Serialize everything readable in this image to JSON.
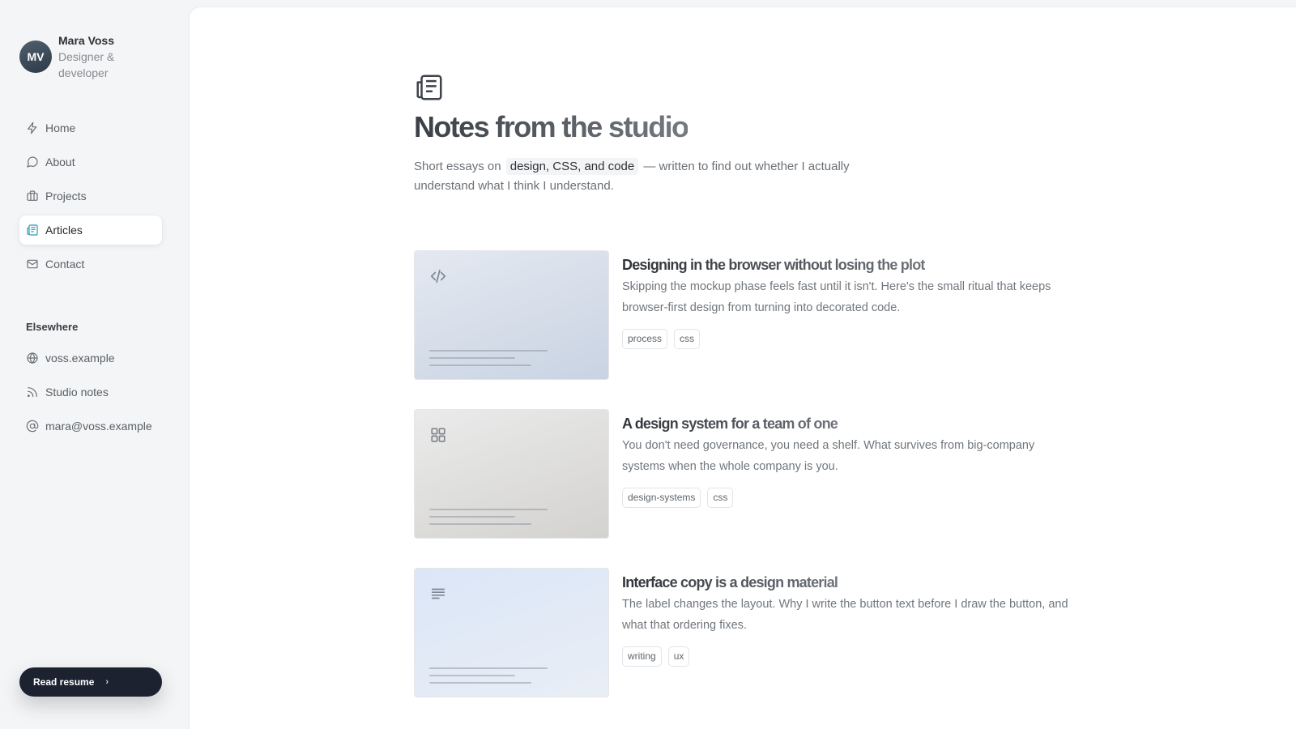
{
  "profile": {
    "initials": "MV",
    "name": "Mara Voss",
    "role": "Designer & developer"
  },
  "nav": {
    "items": [
      {
        "label": "Home",
        "icon": "bolt-icon"
      },
      {
        "label": "About",
        "icon": "chat-bubble-icon"
      },
      {
        "label": "Projects",
        "icon": "briefcase-icon"
      },
      {
        "label": "Articles",
        "icon": "newspaper-icon",
        "active": true
      },
      {
        "label": "Contact",
        "icon": "mail-icon"
      }
    ]
  },
  "elsewhere": {
    "label": "Elsewhere",
    "links": [
      {
        "label": "voss.example",
        "icon": "globe-icon"
      },
      {
        "label": "Studio notes",
        "icon": "rss-icon"
      },
      {
        "label": "mara@voss.example",
        "icon": "at-sign-icon"
      }
    ]
  },
  "resume": {
    "label": "Read resume",
    "chevron": "›"
  },
  "page": {
    "title": "Notes from the studio",
    "desc_before": "Short essays on",
    "desc_chip": "design, CSS, and code",
    "desc_after": "— written to find out whether I actually understand what I think I understand."
  },
  "articles": [
    {
      "title": "Designing in the browser without losing the plot",
      "excerpt": "Skipping the mockup phase feels fast until it isn't. Here's the small ritual that keeps browser-first design from turning into decorated code.",
      "tags": [
        "process",
        "css"
      ],
      "thumb_icon": "code-icon",
      "thumb_colors": [
        "#e4e9f1",
        "#c9d3e2"
      ]
    },
    {
      "title": "A design system for a team of one",
      "excerpt": "You don't need governance, you need a shelf. What survives from big-company systems when the whole company is you.",
      "tags": [
        "design-systems",
        "css"
      ],
      "thumb_icon": "grid-icon",
      "thumb_colors": [
        "#ebebeb",
        "#d3d2d0"
      ]
    },
    {
      "title": "Interface copy is a design material",
      "excerpt": "The label changes the layout. Why I write the button text before I draw the button, and what that ordering fixes.",
      "tags": [
        "writing",
        "ux"
      ],
      "thumb_icon": "text-lines-icon",
      "thumb_colors": [
        "#dbe6f7",
        "#e9eef6"
      ]
    }
  ],
  "colors": {
    "accent": "#2a9bb0",
    "button_dark": "#1c2230",
    "sidebar_bg": "#f4f5f6"
  }
}
